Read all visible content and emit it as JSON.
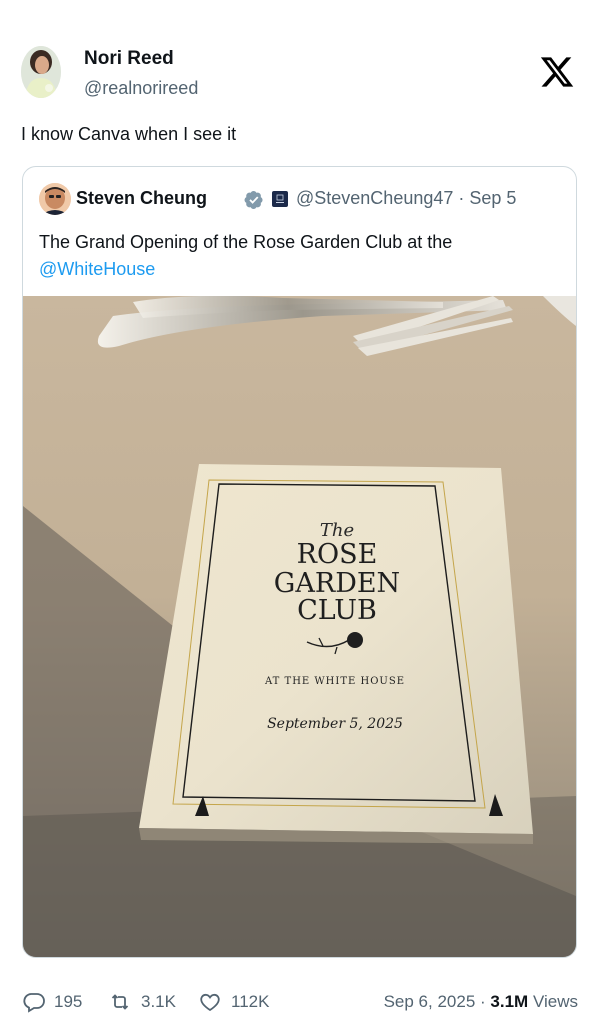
{
  "author": {
    "name": "Nori Reed",
    "handle": "@realnorireed"
  },
  "tweet": {
    "text": "I know Canva when I see it"
  },
  "quoted": {
    "name": "Steven Cheung",
    "handle_date": "@StevenCheung47 · Sep 5",
    "text_before": "The Grand Opening of the Rose Garden Club at the",
    "mention": "@WhiteHouse",
    "card": {
      "the": "The",
      "line1": "ROSE",
      "line2": "GARDEN",
      "line3": "CLUB",
      "arc": "AT THE WHITE HOUSE",
      "date": "September 5, 2025"
    }
  },
  "actions": {
    "replies": "195",
    "reposts": "3.1K",
    "likes": "112K",
    "date": "Sep 6, 2025",
    "separator": "·",
    "views_count": "3.1M",
    "views_label": "Views"
  },
  "colors": {
    "link": "#1d9bf0",
    "secondary_text": "#536471",
    "border": "#cfd9de"
  },
  "icons": [
    "x-logo-icon",
    "verified-badge-icon",
    "affiliate-badge-icon",
    "reply-icon",
    "repost-icon",
    "like-icon"
  ]
}
